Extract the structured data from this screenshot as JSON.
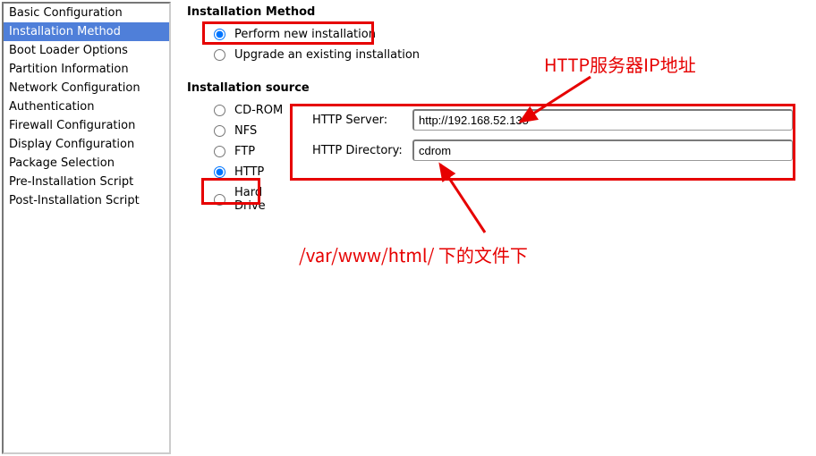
{
  "sidebar": {
    "items": [
      {
        "label": "Basic Configuration"
      },
      {
        "label": "Installation Method"
      },
      {
        "label": "Boot Loader Options"
      },
      {
        "label": "Partition Information"
      },
      {
        "label": "Network Configuration"
      },
      {
        "label": "Authentication"
      },
      {
        "label": "Firewall Configuration"
      },
      {
        "label": "Display Configuration"
      },
      {
        "label": "Package Selection"
      },
      {
        "label": "Pre-Installation Script"
      },
      {
        "label": "Post-Installation Script"
      }
    ],
    "selected_index": 1
  },
  "main": {
    "method": {
      "heading": "Installation Method",
      "options": {
        "new": "Perform new installation",
        "upgrade": "Upgrade an existing installation"
      },
      "selected": "new"
    },
    "source": {
      "heading": "Installation source",
      "options": {
        "cdrom": "CD-ROM",
        "nfs": "NFS",
        "ftp": "FTP",
        "http": "HTTP",
        "hdd": "Hard Drive"
      },
      "selected": "http",
      "http": {
        "server_label": "HTTP Server:",
        "server_value": "http://192.168.52.135",
        "dir_label": "HTTP Directory:",
        "dir_value": "cdrom"
      }
    }
  },
  "annotations": {
    "ip_label": "HTTP服务器IP地址",
    "dir_label": "/var/www/html/ 下的文件下",
    "color": "#e60000"
  }
}
